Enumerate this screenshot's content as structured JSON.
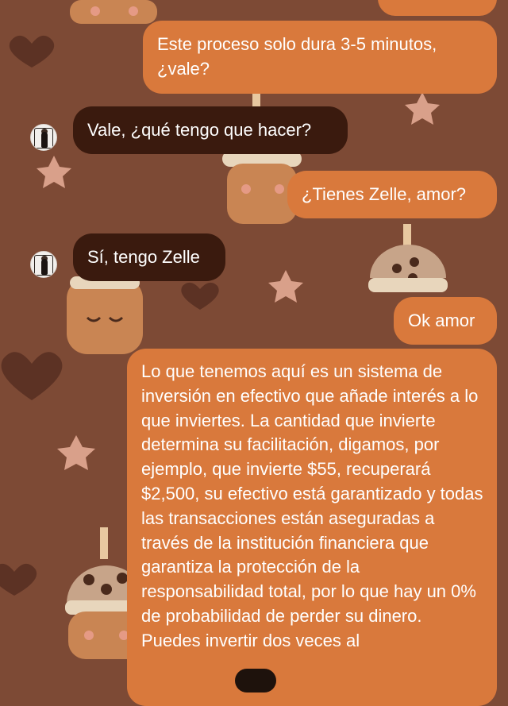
{
  "theme": {
    "outgoing_color": "#d9793c",
    "incoming_color": "#3a1a0e",
    "background_color": "#7d4a35"
  },
  "messages": [
    {
      "side": "outgoing",
      "text": "Este proceso solo dura 3-5 minutos, ¿vale?"
    },
    {
      "side": "incoming",
      "text": "Vale, ¿qué tengo que hacer?"
    },
    {
      "side": "outgoing",
      "text": "¿Tienes Zelle, amor?"
    },
    {
      "side": "incoming",
      "text": "Sí, tengo Zelle"
    },
    {
      "side": "outgoing",
      "text": "Ok amor"
    },
    {
      "side": "outgoing",
      "text": "Lo que tenemos aquí es un sistema de inversión en efectivo que añade interés a lo que inviertes. La cantidad que invierte determina su facilitación, digamos, por ejemplo, que invierte $55, recuperará $2,500, su efectivo está garantizado y todas las transacciones están aseguradas a través de la institución financiera que garantiza la protección de la responsabilidad total, por lo que hay un 0% de probabilidad de perder su dinero. Puedes invertir dos veces al"
    }
  ],
  "avatar_icon": "profile-photo-icon"
}
